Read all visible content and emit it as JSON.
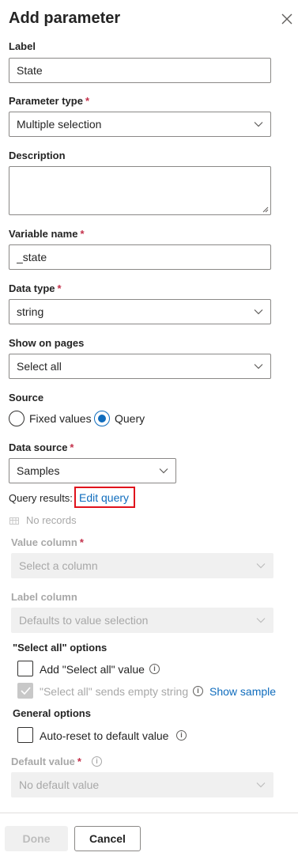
{
  "panel": {
    "title": "Add parameter"
  },
  "form": {
    "label": {
      "label": "Label",
      "value": "State"
    },
    "parameter_type": {
      "label": "Parameter type",
      "required": "*",
      "value": "Multiple selection"
    },
    "description": {
      "label": "Description",
      "value": ""
    },
    "variable_name": {
      "label": "Variable name",
      "required": "*",
      "value": "_state"
    },
    "data_type": {
      "label": "Data type",
      "required": "*",
      "value": "string"
    },
    "show_on_pages": {
      "label": "Show on pages",
      "value": "Select all"
    },
    "source": {
      "label": "Source",
      "options": [
        {
          "label": "Fixed values",
          "selected": false
        },
        {
          "label": "Query",
          "selected": true
        }
      ]
    },
    "data_source": {
      "label": "Data source",
      "required": "*",
      "value": "Samples"
    },
    "query_results": {
      "label": "Query results:",
      "edit_link": "Edit query",
      "no_records": "No records"
    },
    "value_column": {
      "label": "Value column",
      "required": "*",
      "placeholder": "Select a column"
    },
    "label_column": {
      "label": "Label column",
      "value": "Defaults to value selection"
    },
    "select_all_options": {
      "heading": "\"Select all\" options",
      "add_select_all": "Add \"Select all\" value",
      "sends_empty": "\"Select all\" sends empty string",
      "show_sample": "Show sample"
    },
    "general_options": {
      "heading": "General options",
      "auto_reset": "Auto-reset to default value"
    },
    "default_value": {
      "label": "Default value",
      "required": "*",
      "value": "No default value"
    }
  },
  "footer": {
    "done_label": "Done",
    "cancel_label": "Cancel"
  },
  "colors": {
    "accent": "#0f6cbd",
    "required": "#c4314b",
    "highlight": "#e0121c"
  }
}
